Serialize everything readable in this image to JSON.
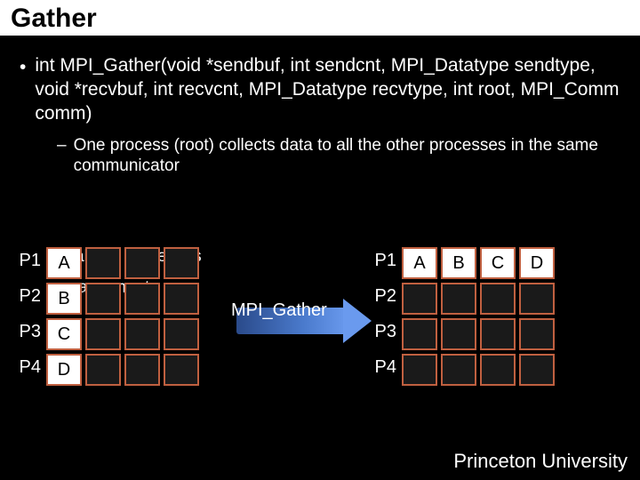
{
  "title": "Gather",
  "signature": {
    "prefix": "int MPI_Gather(void *sendbuf, int sendcnt, MPI_Datatype sendtype, void *recvbuf, int recvcnt, MPI_Datatype recvtype,  int root, MPI_Comm comm)"
  },
  "sub": {
    "line1": "One process (root) collects data to all the other processes in the same communicator",
    "overlap_top": "all the processes",
    "overlap_bottom": "arguments"
  },
  "arrow_label": "MPI_Gather",
  "labels": {
    "p1": "P1",
    "p2": "P2",
    "p3": "P3",
    "p4": "P4"
  },
  "left_grid": {
    "r1": [
      "A",
      "",
      "",
      ""
    ],
    "r2": [
      "B",
      "",
      "",
      ""
    ],
    "r3": [
      "C",
      "",
      "",
      ""
    ],
    "r4": [
      "D",
      "",
      "",
      ""
    ]
  },
  "right_grid": {
    "r1": [
      "A",
      "B",
      "C",
      "D"
    ],
    "r2": [
      "",
      "",
      "",
      ""
    ],
    "r3": [
      "",
      "",
      "",
      ""
    ],
    "r4": [
      "",
      "",
      "",
      ""
    ]
  },
  "footer": "Princeton University"
}
